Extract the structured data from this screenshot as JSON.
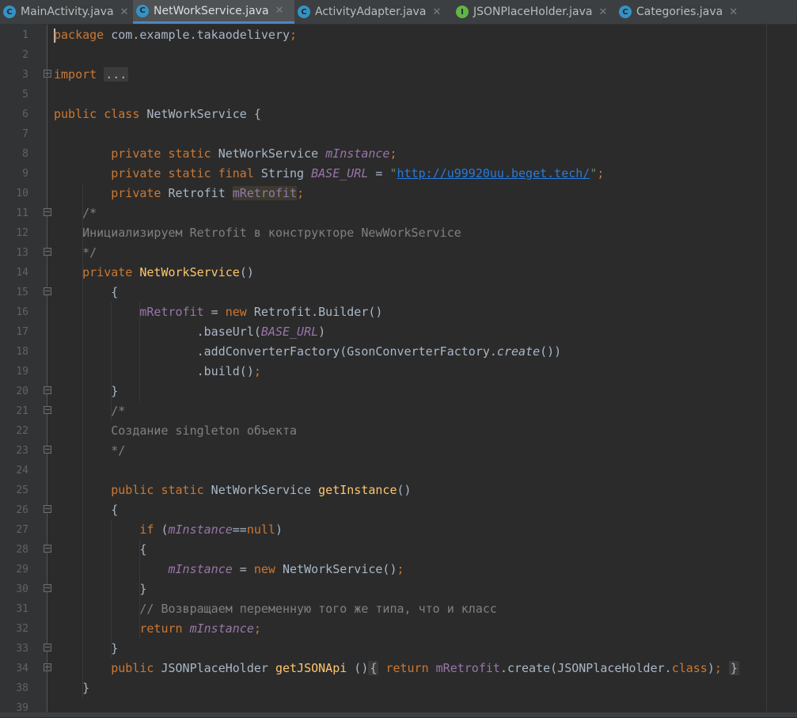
{
  "tabs": [
    {
      "label": "MainActivity.java",
      "icon": "class-icon",
      "icon_glyph": "C",
      "color": "#3592c4"
    },
    {
      "label": "NetWorkService.java",
      "icon": "class-icon",
      "icon_glyph": "C",
      "color": "#3592c4",
      "active": true
    },
    {
      "label": "ActivityAdapter.java",
      "icon": "class-icon",
      "icon_glyph": "C",
      "color": "#3592c4"
    },
    {
      "label": "JSONPlaceHolder.java",
      "icon": "interface-icon",
      "icon_glyph": "I",
      "color": "#62b543"
    },
    {
      "label": "Categories.java",
      "icon": "class-icon",
      "icon_glyph": "C",
      "color": "#3592c4"
    }
  ],
  "close_glyph": "✕",
  "editor": {
    "line_numbers": [
      "1",
      "2",
      "3",
      "5",
      "6",
      "7",
      "8",
      "9",
      "10",
      "11",
      "12",
      "13",
      "14",
      "15",
      "16",
      "17",
      "18",
      "19",
      "20",
      "21",
      "22",
      "23",
      "24",
      "25",
      "26",
      "27",
      "28",
      "29",
      "30",
      "31",
      "32",
      "33",
      "34",
      "38",
      "39"
    ],
    "lines": [
      {
        "tokens": [
          [
            "kw",
            "package"
          ],
          [
            "plain",
            " com.example.takaodelivery"
          ],
          [
            "kw",
            ";"
          ]
        ]
      },
      {
        "tokens": []
      },
      {
        "tokens": [
          [
            "kw",
            "import"
          ],
          [
            "plain",
            " "
          ],
          [
            "fold",
            "..."
          ]
        ]
      },
      {
        "tokens": []
      },
      {
        "tokens": [
          [
            "kw",
            "public class"
          ],
          [
            "plain",
            " NetWorkService {"
          ]
        ]
      },
      {
        "tokens": []
      },
      {
        "tokens": [
          [
            "plain",
            "        "
          ],
          [
            "kw",
            "private static"
          ],
          [
            "plain",
            " NetWorkService "
          ],
          [
            "ifld",
            "mInstance"
          ],
          [
            "kw",
            ";"
          ]
        ]
      },
      {
        "tokens": [
          [
            "plain",
            "        "
          ],
          [
            "kw",
            "private static final"
          ],
          [
            "plain",
            " String "
          ],
          [
            "ifld",
            "BASE_URL"
          ],
          [
            "plain",
            " = "
          ],
          [
            "str",
            "\""
          ],
          [
            "url",
            "http://u99920uu.beget.tech/"
          ],
          [
            "str",
            "\""
          ],
          [
            "kw",
            ";"
          ]
        ]
      },
      {
        "tokens": [
          [
            "plain",
            "        "
          ],
          [
            "kw",
            "private"
          ],
          [
            "plain",
            " Retrofit "
          ],
          [
            "fldhl",
            "mRetrofit"
          ],
          [
            "kw",
            ";"
          ]
        ]
      },
      {
        "tokens": [
          [
            "cmt",
            "    /*"
          ]
        ]
      },
      {
        "tokens": [
          [
            "cmt",
            "    Инициализируем Retrofit в конструкторе NewWorkService"
          ]
        ]
      },
      {
        "tokens": [
          [
            "cmt",
            "    */"
          ]
        ]
      },
      {
        "tokens": [
          [
            "plain",
            "    "
          ],
          [
            "kw",
            "private"
          ],
          [
            "plain",
            " "
          ],
          [
            "mth",
            "NetWorkService"
          ],
          [
            "plain",
            "()"
          ]
        ]
      },
      {
        "tokens": [
          [
            "plain",
            "        {"
          ]
        ]
      },
      {
        "tokens": [
          [
            "plain",
            "            "
          ],
          [
            "fld",
            "mRetrofit"
          ],
          [
            "plain",
            " = "
          ],
          [
            "kw",
            "new"
          ],
          [
            "plain",
            " Retrofit.Builder()"
          ]
        ]
      },
      {
        "tokens": [
          [
            "plain",
            "                    .baseUrl("
          ],
          [
            "ifld",
            "BASE_URL"
          ],
          [
            "plain",
            ")"
          ]
        ]
      },
      {
        "tokens": [
          [
            "plain",
            "                    .addConverterFactory(GsonConverterFactory."
          ],
          [
            "istat",
            "create"
          ],
          [
            "plain",
            "())"
          ]
        ]
      },
      {
        "tokens": [
          [
            "plain",
            "                    .build()"
          ],
          [
            "kw",
            ";"
          ]
        ]
      },
      {
        "tokens": [
          [
            "plain",
            "        }"
          ]
        ]
      },
      {
        "tokens": [
          [
            "cmt",
            "        /*"
          ]
        ]
      },
      {
        "tokens": [
          [
            "cmt",
            "        Создание singleton объекта"
          ]
        ]
      },
      {
        "tokens": [
          [
            "cmt",
            "        */"
          ]
        ]
      },
      {
        "tokens": []
      },
      {
        "tokens": [
          [
            "plain",
            "        "
          ],
          [
            "kw",
            "public static"
          ],
          [
            "plain",
            " NetWorkService "
          ],
          [
            "mth",
            "getInstance"
          ],
          [
            "plain",
            "()"
          ]
        ]
      },
      {
        "tokens": [
          [
            "plain",
            "        {"
          ]
        ]
      },
      {
        "tokens": [
          [
            "plain",
            "            "
          ],
          [
            "kw",
            "if"
          ],
          [
            "plain",
            " ("
          ],
          [
            "ifld",
            "mInstance"
          ],
          [
            "plain",
            "=="
          ],
          [
            "kw",
            "null"
          ],
          [
            "plain",
            ")"
          ]
        ]
      },
      {
        "tokens": [
          [
            "plain",
            "            {"
          ]
        ]
      },
      {
        "tokens": [
          [
            "plain",
            "                "
          ],
          [
            "ifld",
            "mInstance"
          ],
          [
            "plain",
            " = "
          ],
          [
            "kw",
            "new"
          ],
          [
            "plain",
            " NetWorkService()"
          ],
          [
            "kw",
            ";"
          ]
        ]
      },
      {
        "tokens": [
          [
            "plain",
            "            }"
          ]
        ]
      },
      {
        "tokens": [
          [
            "cmt",
            "            // Возвращаем переменную того же типа, что и класс"
          ]
        ]
      },
      {
        "tokens": [
          [
            "plain",
            "            "
          ],
          [
            "kw",
            "return"
          ],
          [
            "plain",
            " "
          ],
          [
            "ifld",
            "mInstance"
          ],
          [
            "kw",
            ";"
          ]
        ]
      },
      {
        "tokens": [
          [
            "plain",
            "        }"
          ]
        ]
      },
      {
        "tokens": [
          [
            "plain",
            "        "
          ],
          [
            "kw",
            "public"
          ],
          [
            "plain",
            " JSONPlaceHolder "
          ],
          [
            "mth",
            "getJSONApi"
          ],
          [
            "plain",
            " ()"
          ],
          [
            "fold",
            "{"
          ],
          [
            "plain",
            " "
          ],
          [
            "kw",
            "return"
          ],
          [
            "plain",
            " "
          ],
          [
            "fld",
            "mRetrofit"
          ],
          [
            "plain",
            ".create(JSONPlaceHolder."
          ],
          [
            "kw",
            "class"
          ],
          [
            "plain",
            ")"
          ],
          [
            "kw",
            ";"
          ],
          [
            "plain",
            " "
          ],
          [
            "fold",
            "}"
          ]
        ]
      },
      {
        "tokens": [
          [
            "plain",
            "    }"
          ]
        ]
      },
      {
        "tokens": []
      }
    ]
  }
}
